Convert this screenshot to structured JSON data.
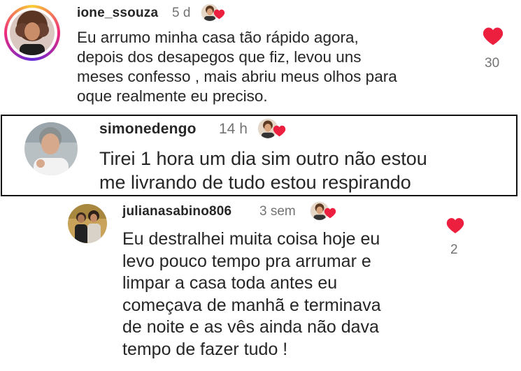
{
  "comments": [
    {
      "username": "ione_ssouza",
      "time": "5 d",
      "lines": [
        "Eu arrumo minha casa tão rápido agora,",
        "depois dos desapegos que fiz, levou uns",
        "meses confesso , mais abriu meus olhos para",
        "oque realmente eu preciso."
      ],
      "likes": "30"
    },
    {
      "username": "simonedengo",
      "time": "14 h",
      "lines": [
        "Tirei 1 hora um dia sim outro não estou",
        "me livrando de tudo estou respirando"
      ]
    },
    {
      "username": "julianasabino806",
      "time": "3 sem",
      "lines": [
        "Eu destralhei muita coisa hoje eu",
        "levo pouco tempo pra arrumar e",
        "limpar a casa toda antes eu",
        "começava de manhã e terminava",
        "de noite e as vês ainda não dava",
        "tempo de fazer tudo !"
      ],
      "likes": "2"
    }
  ],
  "colors": {
    "like": "#ed1f3f",
    "story_ring": [
      "#f9ce34",
      "#ee2a7b",
      "#6228d7"
    ],
    "creator_heart": "#ed1f3f"
  },
  "icons": {
    "like": "heart-icon",
    "creator_liked": "creator-heart-icon"
  }
}
